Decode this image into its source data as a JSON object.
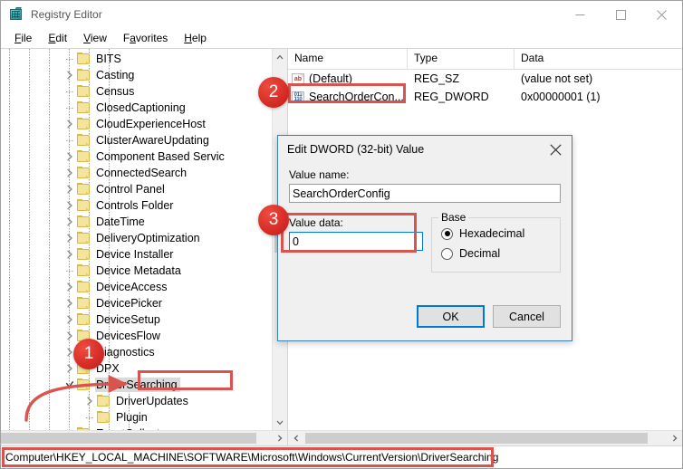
{
  "window": {
    "title": "Registry Editor",
    "icon": "registry-editor-icon",
    "controls": {
      "minimize": "minimize-icon",
      "maximize": "maximize-icon",
      "close": "close-icon"
    }
  },
  "menubar": {
    "items": [
      {
        "label": "File",
        "accel": "F"
      },
      {
        "label": "Edit",
        "accel": "E"
      },
      {
        "label": "View",
        "accel": "V"
      },
      {
        "label": "Favorites",
        "accel": "a"
      },
      {
        "label": "Help",
        "accel": "H"
      }
    ]
  },
  "tree": {
    "items": [
      {
        "label": "BITS",
        "indent": 4,
        "expandable": false,
        "selected": false,
        "last": false
      },
      {
        "label": "Casting",
        "indent": 4,
        "expandable": true,
        "selected": false,
        "last": false
      },
      {
        "label": "Census",
        "indent": 4,
        "expandable": false,
        "selected": false,
        "last": false
      },
      {
        "label": "ClosedCaptioning",
        "indent": 4,
        "expandable": false,
        "selected": false,
        "last": false
      },
      {
        "label": "CloudExperienceHost",
        "indent": 4,
        "expandable": true,
        "selected": false,
        "last": false
      },
      {
        "label": "ClusterAwareUpdating",
        "indent": 4,
        "expandable": false,
        "selected": false,
        "last": false
      },
      {
        "label": "Component Based Servic",
        "indent": 4,
        "expandable": true,
        "selected": false,
        "last": false
      },
      {
        "label": "ConnectedSearch",
        "indent": 4,
        "expandable": true,
        "selected": false,
        "last": false
      },
      {
        "label": "Control Panel",
        "indent": 4,
        "expandable": true,
        "selected": false,
        "last": false
      },
      {
        "label": "Controls Folder",
        "indent": 4,
        "expandable": true,
        "selected": false,
        "last": false
      },
      {
        "label": "DateTime",
        "indent": 4,
        "expandable": true,
        "selected": false,
        "last": false
      },
      {
        "label": "DeliveryOptimization",
        "indent": 4,
        "expandable": true,
        "selected": false,
        "last": false
      },
      {
        "label": "Device Installer",
        "indent": 4,
        "expandable": true,
        "selected": false,
        "last": false
      },
      {
        "label": "Device Metadata",
        "indent": 4,
        "expandable": false,
        "selected": false,
        "last": false
      },
      {
        "label": "DeviceAccess",
        "indent": 4,
        "expandable": true,
        "selected": false,
        "last": false
      },
      {
        "label": "DevicePicker",
        "indent": 4,
        "expandable": true,
        "selected": false,
        "last": false
      },
      {
        "label": "DeviceSetup",
        "indent": 4,
        "expandable": true,
        "selected": false,
        "last": false
      },
      {
        "label": "DevicesFlow",
        "indent": 4,
        "expandable": true,
        "selected": false,
        "last": false
      },
      {
        "label": "Diagnostics",
        "indent": 4,
        "expandable": true,
        "selected": false,
        "last": false
      },
      {
        "label": "DPX",
        "indent": 4,
        "expandable": true,
        "selected": false,
        "last": false
      },
      {
        "label": "DriverSearching",
        "indent": 4,
        "expandable": true,
        "expanded": true,
        "selected": true,
        "last": false
      },
      {
        "label": "DriverUpdates",
        "indent": 5,
        "expandable": true,
        "selected": false,
        "last": false
      },
      {
        "label": "Plugin",
        "indent": 5,
        "expandable": false,
        "selected": false,
        "last": true
      },
      {
        "label": "EventCollector",
        "indent": 4,
        "expandable": false,
        "selected": false,
        "last": false
      }
    ]
  },
  "list": {
    "columns": [
      "Name",
      "Type",
      "Data"
    ],
    "rows": [
      {
        "icon": "string-value-icon",
        "name": "(Default)",
        "type": "REG_SZ",
        "data": "(value not set)"
      },
      {
        "icon": "dword-value-icon",
        "name": "SearchOrderCon...",
        "type": "REG_DWORD",
        "data": "0x00000001 (1)"
      }
    ]
  },
  "statusbar": {
    "path": "Computer\\HKEY_LOCAL_MACHINE\\SOFTWARE\\Microsoft\\Windows\\CurrentVersion\\DriverSearching"
  },
  "dialog": {
    "title": "Edit DWORD (32-bit) Value",
    "close_icon": "close-icon",
    "value_name_label": "Value name:",
    "value_name": "SearchOrderConfig",
    "value_data_label": "Value data:",
    "value_data": "0",
    "base_group_label": "Base",
    "base_options": [
      {
        "label": "Hexadecimal",
        "selected": true
      },
      {
        "label": "Decimal",
        "selected": false
      }
    ],
    "ok_label": "OK",
    "cancel_label": "Cancel"
  },
  "annotations": {
    "color": "#d9544f",
    "badges": [
      {
        "number": "1"
      },
      {
        "number": "2"
      },
      {
        "number": "3"
      }
    ],
    "arrow": "curved-red-arrow"
  }
}
